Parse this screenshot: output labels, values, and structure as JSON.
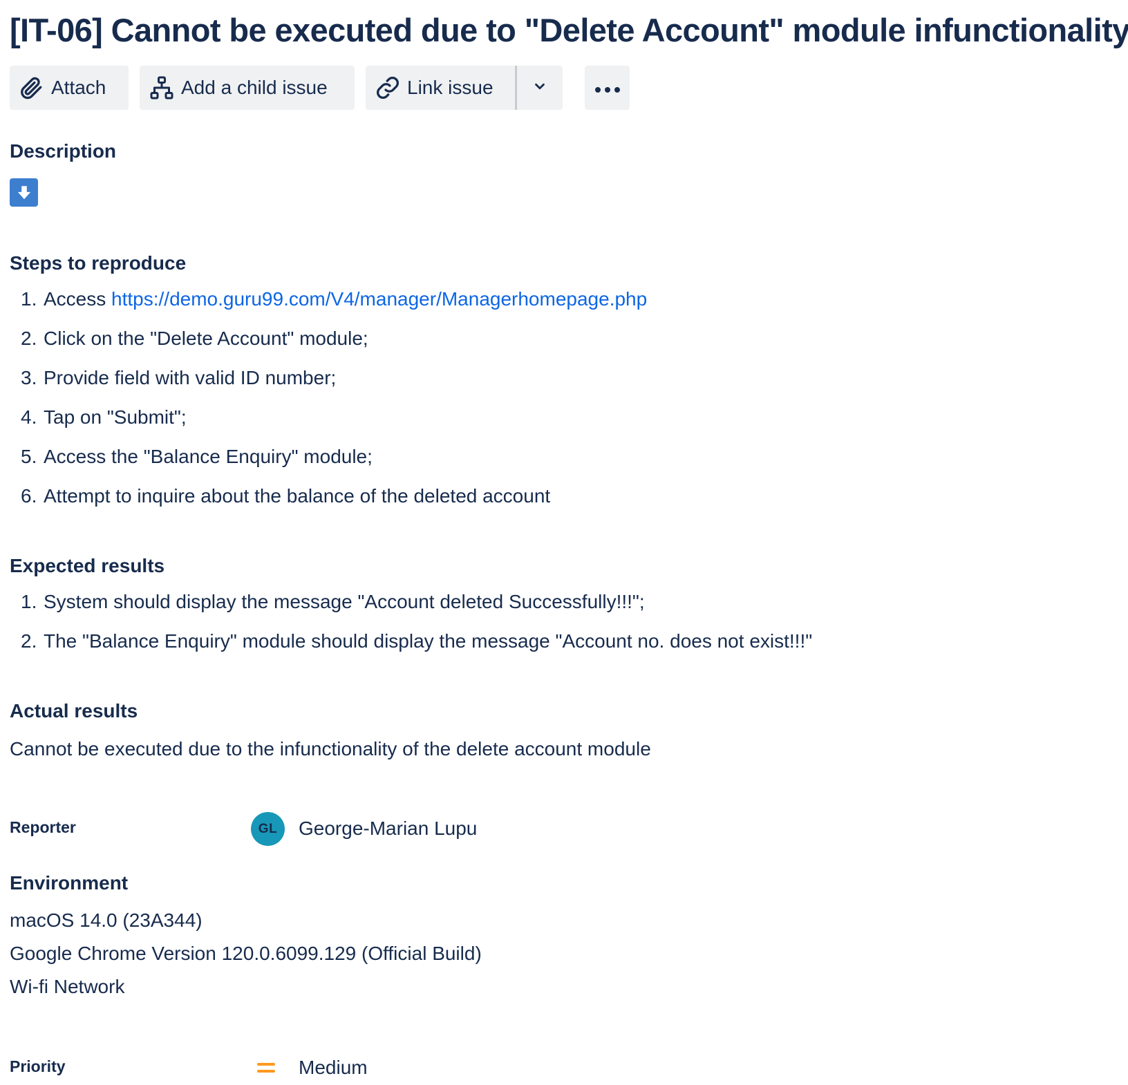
{
  "issue": {
    "title": "[IT-06] Cannot be executed due to \"Delete Account\" module infunctionality"
  },
  "toolbar": {
    "attach_label": "Attach",
    "child_issue_label": "Add a child issue",
    "link_issue_label": "Link issue"
  },
  "description": {
    "heading": "Description",
    "steps": {
      "heading": "Steps to reproduce",
      "items": [
        {
          "num": "1.",
          "prefix": "Access ",
          "link": "https://demo.guru99.com/V4/manager/Managerhomepage.php"
        },
        {
          "num": "2.",
          "text": "Click on the \"Delete Account\" module;"
        },
        {
          "num": "3.",
          "text": "Provide field with valid ID number;"
        },
        {
          "num": "4.",
          "text": "Tap on \"Submit\";"
        },
        {
          "num": "5.",
          "text": "Access the \"Balance Enquiry\" module;"
        },
        {
          "num": "6.",
          "text": "Attempt to inquire about the balance of the deleted account"
        }
      ]
    },
    "expected": {
      "heading": "Expected results",
      "items": [
        {
          "num": "1.",
          "text": "System should display the message \"Account deleted Successfully!!!\";"
        },
        {
          "num": "2.",
          "text": "The \"Balance Enquiry\" module should display the message \"Account no. does not exist!!!\""
        }
      ]
    },
    "actual": {
      "heading": "Actual results",
      "text": "Cannot be executed due to the infunctionality of the delete account module"
    }
  },
  "reporter": {
    "label": "Reporter",
    "initials": "GL",
    "name": "George-Marian Lupu",
    "avatar_color": "#1798b8"
  },
  "environment": {
    "heading": "Environment",
    "lines": [
      "macOS 14.0 (23A344)",
      "Google Chrome Version 120.0.6099.129 (Official Build)",
      "Wi-fi Network"
    ]
  },
  "priority": {
    "label": "Priority",
    "value": "Medium",
    "icon": "priority-medium-icon",
    "icon_color": "#ff991f"
  },
  "colors": {
    "text": "#172b4d",
    "link": "#0c66e4",
    "button_bg": "#f0f1f3",
    "accent_blue": "#3d7ecf"
  }
}
